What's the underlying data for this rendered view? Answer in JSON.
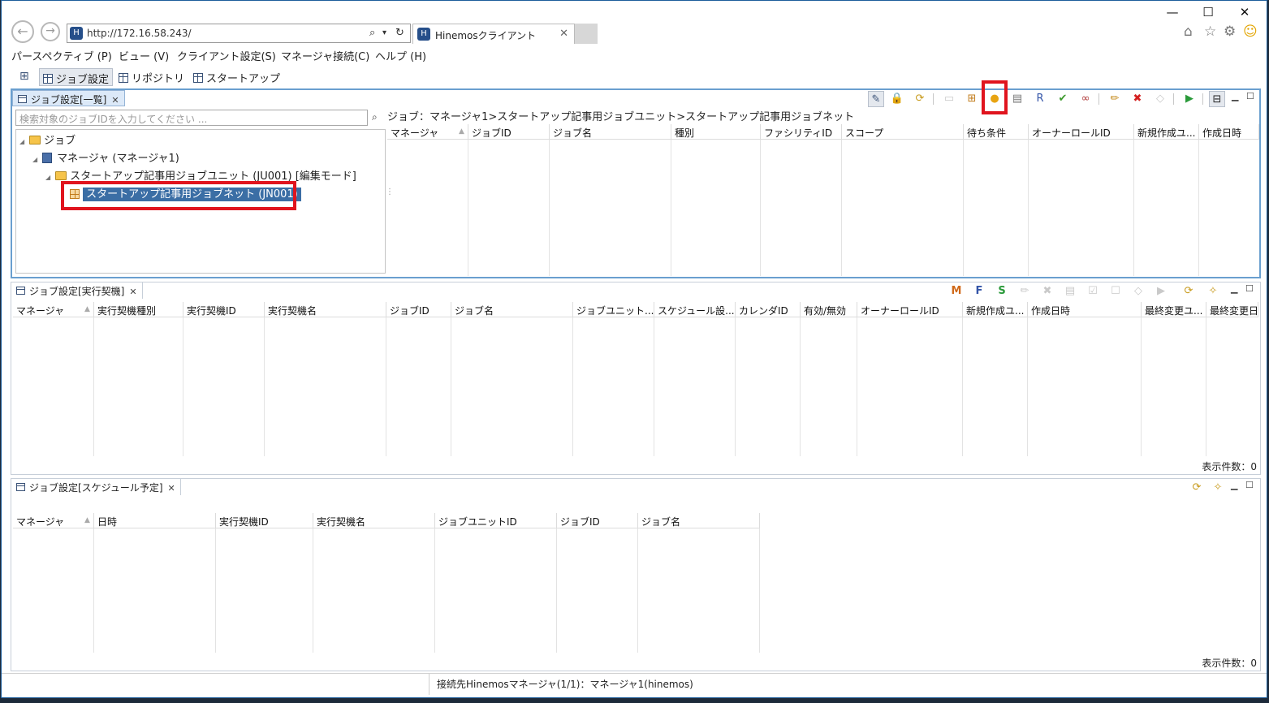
{
  "browser": {
    "back_glyph": "←",
    "forward_glyph": "→",
    "url": "http://172.16.58.243/",
    "address_controls": [
      "⌕",
      "▾",
      "↻"
    ],
    "tab_title": "Hinemosクライアント",
    "tab_close": "✕",
    "window_controls": [
      "—",
      "☐",
      "✕"
    ],
    "toolbar_icons": [
      "⌂",
      "☆",
      "⚙",
      "☺"
    ]
  },
  "menu": [
    "パースペクティブ (P)",
    "ビュー (V)",
    "クライアント設定(S)",
    "マネージャ接続(C)",
    "ヘルプ (H)"
  ],
  "perspectives": [
    "ジョブ設定",
    "リポジトリ",
    "スタートアップ"
  ],
  "list_view": {
    "tab_label": "ジョブ設定[一覧]",
    "close": "✕",
    "search_placeholder": "検索対象のジョブIDを入力してください ...",
    "search_icon": "⌕",
    "tree": {
      "root": "ジョブ",
      "manager": "マネージャ (マネージャ1)",
      "unit": "スタートアップ記事用ジョブユニット (JU001) [編集モード]",
      "net": "スタートアップ記事用ジョブネット (JN001)"
    },
    "breadcrumb": "ジョブ：マネージャ1>スタートアップ記事用ジョブユニット>スタートアップ記事用ジョブネット",
    "columns": [
      "マネージャ",
      "ジョブID",
      "ジョブ名",
      "種別",
      "ファシリティID",
      "スコープ",
      "待ち条件",
      "オーナーロールID",
      "新規作成ユ...",
      "作成日時"
    ]
  },
  "kick_view": {
    "tab_label": "ジョブ設定[実行契機]",
    "close": "✕",
    "columns": [
      "マネージャ",
      "実行契機種別",
      "実行契機ID",
      "実行契機名",
      "ジョブID",
      "ジョブ名",
      "ジョブユニット...",
      "スケジュール設...",
      "カレンダID",
      "有効/無効",
      "オーナーロールID",
      "新規作成ユ...",
      "作成日時",
      "最終変更ユ...",
      "最終変更日"
    ],
    "count": "表示件数：0"
  },
  "schedule_view": {
    "tab_label": "ジョブ設定[スケジュール予定]",
    "close": "✕",
    "columns": [
      "マネージャ",
      "日時",
      "実行契機ID",
      "実行契機名",
      "ジョブユニットID",
      "ジョブID",
      "ジョブ名"
    ],
    "count": "表示件数：0"
  },
  "status": "接続先Hinemosマネージャ(1/1)：マネージャ1(hinemos)",
  "colors": {
    "accent": "#3b6ea5",
    "highlight": "#e0141e"
  }
}
